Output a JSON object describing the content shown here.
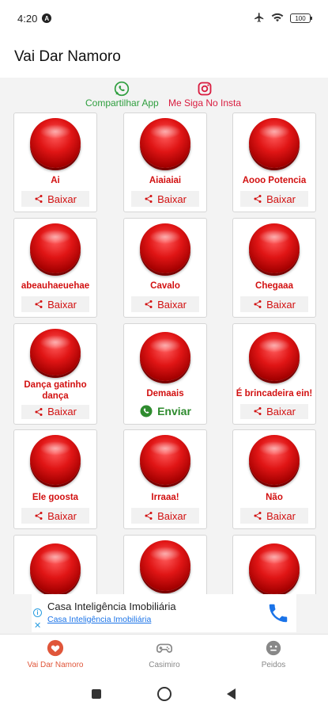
{
  "status": {
    "time": "4:20",
    "a_badge": "A",
    "battery": "100"
  },
  "app": {
    "title": "Vai Dar Namoro"
  },
  "share": {
    "whatsapp_label": "Compartilhar App",
    "instagram_label": "Me Siga No Insta"
  },
  "cards": [
    {
      "label": "Ai",
      "action": "Baixar"
    },
    {
      "label": "Aiaiaiai",
      "action": "Baixar"
    },
    {
      "label": "Aooo Potencia",
      "action": "Baixar"
    },
    {
      "label": "abeauhaeuehae",
      "action": "Baixar"
    },
    {
      "label": "Cavalo",
      "action": "Baixar"
    },
    {
      "label": "Chegaaa",
      "action": "Baixar"
    },
    {
      "label": "Dança gatinho dança",
      "action": "Baixar"
    },
    {
      "label": "Demaais",
      "action": "Enviar"
    },
    {
      "label": "É brincadeira ein!",
      "action": "Baixar"
    },
    {
      "label": "Ele goosta",
      "action": "Baixar"
    },
    {
      "label": "Irraaa!",
      "action": "Baixar"
    },
    {
      "label": "Não",
      "action": "Baixar"
    }
  ],
  "ad": {
    "info": "i",
    "close": "✕",
    "title": "Casa Inteligência Imobiliária",
    "subtitle": "Casa Inteligência Imobiliária"
  },
  "bottom_nav": [
    {
      "label": "Vai Dar Namoro",
      "icon": "heart-icon",
      "active": true
    },
    {
      "label": "Casimiro",
      "icon": "gamepad-icon",
      "active": false
    },
    {
      "label": "Peidos",
      "icon": "face-icon",
      "active": false
    }
  ],
  "colors": {
    "accent_red": "#d21010",
    "whatsapp_green": "#2e9e3e",
    "nav_active": "#e0563a"
  }
}
